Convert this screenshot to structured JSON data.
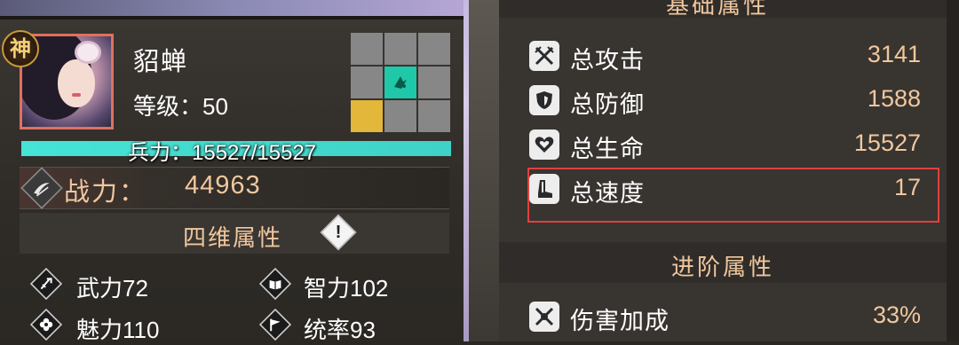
{
  "hero": {
    "badge": "神",
    "name": "貂蝉",
    "level_label": "等级：",
    "level_value": "50",
    "troops_text": "兵力：15527/15527",
    "troops_fraction": 1.0,
    "power_label": "战力：",
    "power_value": "44963"
  },
  "formation_grid": {
    "cells": [
      "gray",
      "gray",
      "gray",
      "gray",
      "teal",
      "gray",
      "yellow",
      "gray",
      "gray"
    ]
  },
  "four_dimensions": {
    "title": "四维属性",
    "info_symbol": "!",
    "stats": [
      {
        "label": "武力",
        "value": "72",
        "icon": "sword-icon"
      },
      {
        "label": "智力",
        "value": "102",
        "icon": "book-icon"
      },
      {
        "label": "魅力",
        "value": "110",
        "icon": "flower-icon"
      },
      {
        "label": "统率",
        "value": "93",
        "icon": "banner-icon"
      }
    ]
  },
  "basic_attributes": {
    "title": "基础属性",
    "rows": [
      {
        "label": "总攻击",
        "value": "3141",
        "icon": "crossed-swords-icon"
      },
      {
        "label": "总防御",
        "value": "1588",
        "icon": "shield-icon"
      },
      {
        "label": "总生命",
        "value": "15527",
        "icon": "heart-icon"
      },
      {
        "label": "总速度",
        "value": "17",
        "icon": "boot-icon",
        "highlighted": true
      }
    ]
  },
  "advanced_attributes": {
    "title": "进阶属性",
    "rows": [
      {
        "label": "伤害加成",
        "value": "33%",
        "icon": "damage-bonus-icon"
      }
    ]
  },
  "colors": {
    "accent_gold": "#f0c79e",
    "troop_bar": "#45e4d6",
    "highlight_border": "#e04040",
    "grid_teal": "#1fc8a8",
    "grid_yellow": "#e2b73a"
  }
}
